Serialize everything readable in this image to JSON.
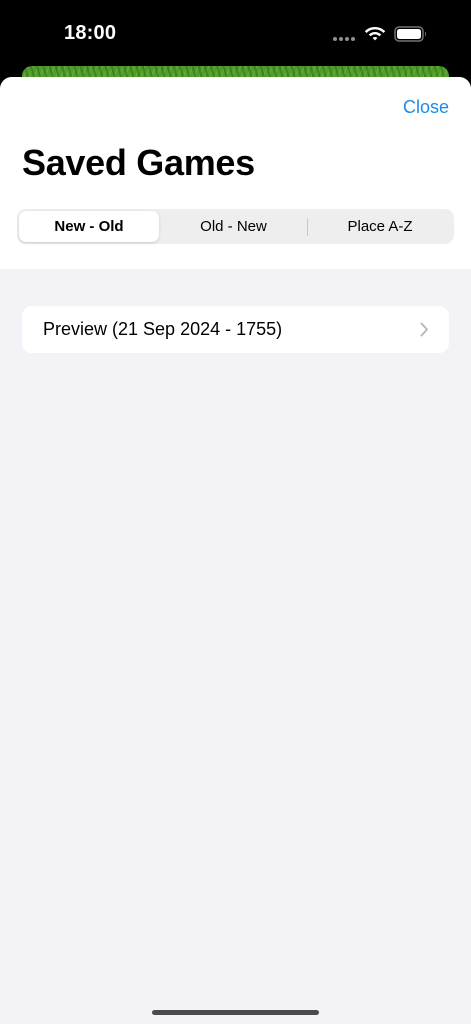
{
  "status_bar": {
    "time": "18:00",
    "icons": [
      "signal-dots-icon",
      "wifi-icon",
      "battery-icon"
    ]
  },
  "sheet": {
    "close_label": "Close",
    "title": "Saved Games",
    "sort_segments": [
      {
        "label": "New - Old",
        "selected": true
      },
      {
        "label": "Old - New",
        "selected": false
      },
      {
        "label": "Place A-Z",
        "selected": false
      }
    ],
    "saved_games": [
      {
        "label": "Preview (21 Sep 2024 - 1755)",
        "icon": "chevron-right-icon"
      }
    ]
  },
  "colors": {
    "accent": "#1a8cf0",
    "background": "#f2f2f7",
    "card": "#ffffff"
  }
}
